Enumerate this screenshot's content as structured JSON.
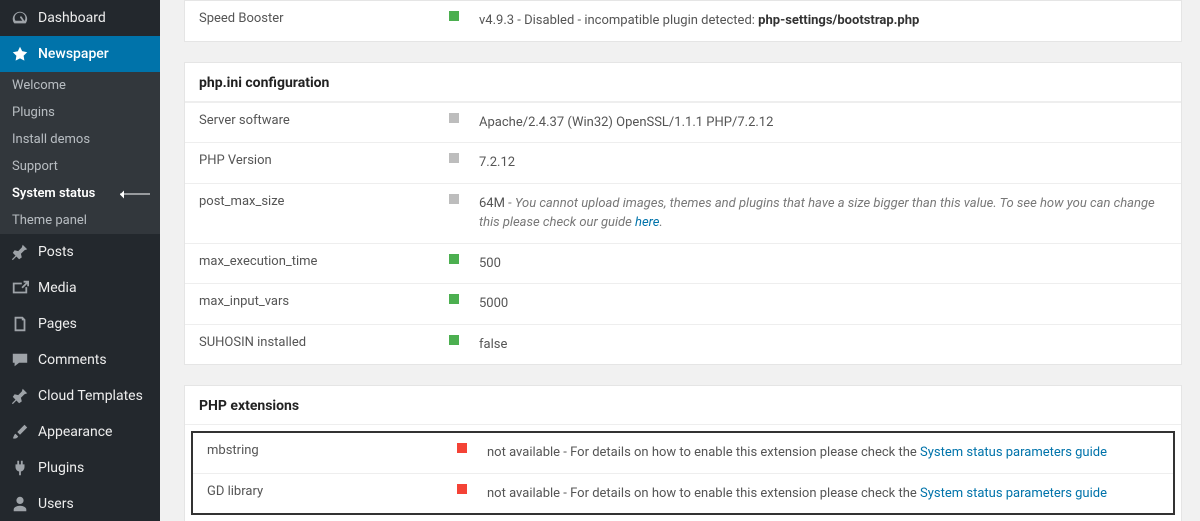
{
  "sidebar": {
    "items": [
      {
        "label": "Dashboard",
        "icon": "dashboard-icon"
      },
      {
        "label": "Newspaper",
        "icon": "newspaper-icon",
        "active": true
      },
      {
        "label": "Posts",
        "icon": "pin-icon"
      },
      {
        "label": "Media",
        "icon": "media-icon"
      },
      {
        "label": "Pages",
        "icon": "pages-icon"
      },
      {
        "label": "Comments",
        "icon": "comments-icon"
      },
      {
        "label": "Cloud Templates",
        "icon": "pin-icon"
      },
      {
        "label": "Appearance",
        "icon": "brush-icon"
      },
      {
        "label": "Plugins",
        "icon": "plug-icon"
      },
      {
        "label": "Users",
        "icon": "user-icon"
      }
    ],
    "submenu": [
      {
        "label": "Welcome"
      },
      {
        "label": "Plugins"
      },
      {
        "label": "Install demos"
      },
      {
        "label": "Support"
      },
      {
        "label": "System status",
        "current": true
      },
      {
        "label": "Theme panel"
      }
    ]
  },
  "topPanel": {
    "row": {
      "label": "Speed Booster",
      "status": "green",
      "value_prefix": "v4.9.3 - Disabled - incompatible plugin detected: ",
      "value_bold": "php-settings/bootstrap.php"
    }
  },
  "phpIni": {
    "title": "php.ini configuration",
    "rows": [
      {
        "label": "Server software",
        "status": "gray",
        "value": "Apache/2.4.37 (Win32) OpenSSL/1.1.1 PHP/7.2.12"
      },
      {
        "label": "PHP Version",
        "status": "gray",
        "value": "7.2.12"
      },
      {
        "label": "post_max_size",
        "status": "gray",
        "value_prefix": "64M",
        "note": " - You cannot upload images, themes and plugins that have a size bigger than this value. To see how you can change this please check our guide ",
        "link_text": "here",
        "note_suffix": "."
      },
      {
        "label": "max_execution_time",
        "status": "green",
        "value": "500"
      },
      {
        "label": "max_input_vars",
        "status": "green",
        "value": "5000"
      },
      {
        "label": "SUHOSIN installed",
        "status": "green",
        "value": "false"
      }
    ]
  },
  "phpExt": {
    "title": "PHP extensions",
    "rows": [
      {
        "label": "mbstring",
        "status": "red",
        "value_prefix": "not available - For details on how to enable this extension please check the ",
        "link_text": "System status parameters guide"
      },
      {
        "label": "GD library",
        "status": "red",
        "value_prefix": "not available - For details on how to enable this extension please check the ",
        "link_text": "System status parameters guide"
      }
    ]
  }
}
